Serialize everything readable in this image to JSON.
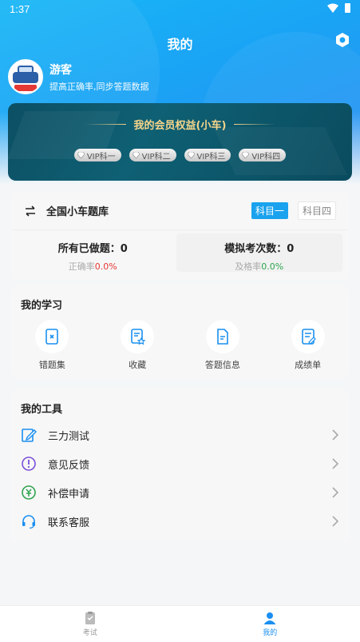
{
  "status_bar": {
    "time": "1:37"
  },
  "header": {
    "title": "我的"
  },
  "profile": {
    "name": "游客",
    "subtitle": "提高正确率,同步答题数据"
  },
  "vip": {
    "title": "我的会员权益(小车)",
    "badges": [
      "VIP科一",
      "VIP科二",
      "VIP科三",
      "VIP科四"
    ]
  },
  "question_bank": {
    "name": "全国小车题库",
    "subjects": [
      {
        "label": "科目一",
        "active": true
      },
      {
        "label": "科目四",
        "active": false
      }
    ],
    "done": {
      "label": "所有已做题：",
      "value": "0",
      "rate_label": "正确率",
      "rate_value": "0.0%"
    },
    "exam": {
      "label": "模拟考次数：",
      "value": "0",
      "rate_label": "及格率",
      "rate_value": "0.0%"
    }
  },
  "study": {
    "title": "我的学习",
    "items": [
      {
        "label": "错题集",
        "icon": "wrong-book-icon"
      },
      {
        "label": "收藏",
        "icon": "favorite-icon"
      },
      {
        "label": "答题信息",
        "icon": "answer-info-icon"
      },
      {
        "label": "成绩单",
        "icon": "score-report-icon"
      }
    ]
  },
  "tools": {
    "title": "我的工具",
    "items": [
      {
        "label": "三力测试",
        "icon": "edit-test-icon"
      },
      {
        "label": "意见反馈",
        "icon": "feedback-icon"
      },
      {
        "label": "补偿申请",
        "icon": "compensation-icon"
      },
      {
        "label": "联系客服",
        "icon": "headset-icon"
      }
    ]
  },
  "tabbar": {
    "items": [
      {
        "label": "考试",
        "active": false
      },
      {
        "label": "我的",
        "active": true
      }
    ]
  },
  "colors": {
    "accent": "#1aa2ee",
    "vip_gold": "#f5d58b",
    "rate_red": "#e53935",
    "rate_green": "#2ea44f"
  }
}
